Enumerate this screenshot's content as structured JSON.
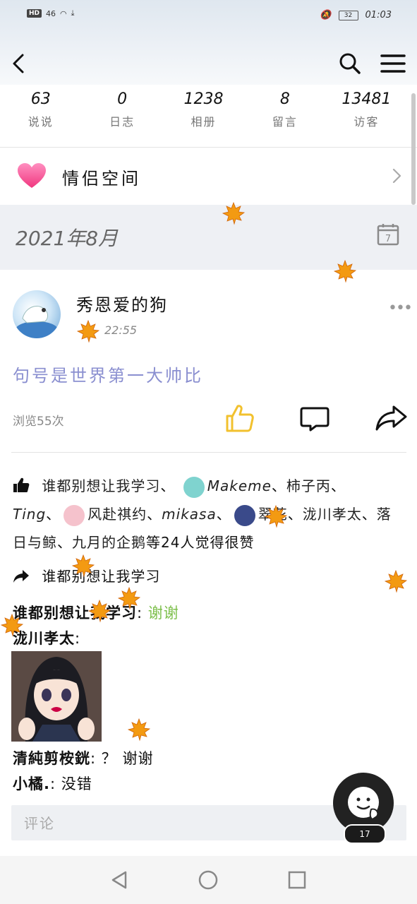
{
  "status_bar": {
    "network_badge": "HD",
    "signal": "46",
    "battery": "32",
    "time": "01:03"
  },
  "stats": [
    {
      "value": "63",
      "label": "说说"
    },
    {
      "value": "0",
      "label": "日志"
    },
    {
      "value": "1238",
      "label": "相册"
    },
    {
      "value": "8",
      "label": "留言"
    },
    {
      "value": "13481",
      "label": "访客"
    }
  ],
  "couple_space": {
    "label": "情侣空间"
  },
  "month_header": {
    "label": "2021年8月",
    "calendar_day": "7"
  },
  "post": {
    "username": "秀恩爱的狗",
    "time": "22:55",
    "text": "句号是世界第一大帅比",
    "views": "浏览55次"
  },
  "likes": {
    "u1": "谁都别想让我学习",
    "u2": "Makeme",
    "u3": "柿子丙",
    "u4": "Ting",
    "u5": "风赴祺约",
    "u6": "mikasa",
    "u7": "翠花",
    "u8": "泷川孝太",
    "u9": "落日与鲸",
    "u10": "九月的企鹅",
    "sep": "、",
    "tail": "等24人觉得很赞"
  },
  "shares": {
    "user": "谁都别想让我学习"
  },
  "comments": [
    {
      "author": "谁都别想让我学习",
      "sep": ":",
      "text": "谢谢"
    },
    {
      "author": "泷川孝太",
      "sep": ":",
      "text": ""
    },
    {
      "author": "清純剪桉銧",
      "sep": ":",
      "text": "？ 谢谢"
    },
    {
      "author": "小橘.",
      "sep": ":",
      "text": "没错"
    }
  ],
  "comment_input": {
    "placeholder": "评论"
  },
  "fab": {
    "badge": "17"
  },
  "colors": {
    "accent_purple": "#8a8fd0",
    "like_yellow": "#f2c12e",
    "green": "#7cbf4a",
    "leaf_orange": "#f39a12"
  }
}
